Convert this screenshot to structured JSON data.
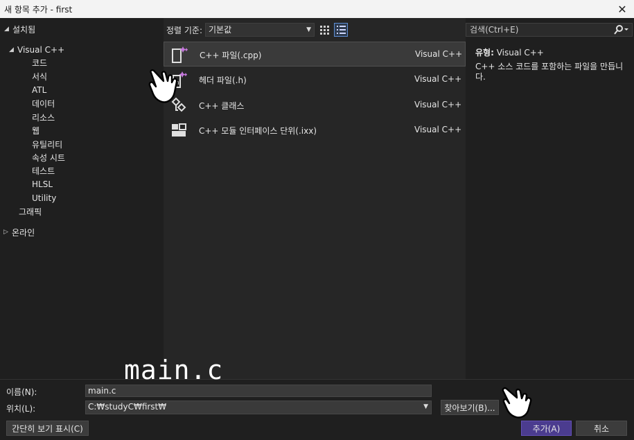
{
  "window": {
    "title": "새 항목 추가 - first",
    "close_glyph": "✕"
  },
  "left": {
    "installed": "설치됨",
    "visual_cpp": "Visual C++",
    "children": [
      "코드",
      "서식",
      "ATL",
      "데이터",
      "리소스",
      "웹",
      "유틸리티",
      "속성 시트",
      "테스트",
      "HLSL",
      "Utility"
    ],
    "graphics": "그래픽",
    "online": "온라인"
  },
  "toolbar": {
    "sort_label": "정렬 기준:",
    "sort_value": "기본값"
  },
  "templates": [
    {
      "name": "C++ 파일(.cpp)",
      "type": "Visual C++",
      "icon": "cpp-file-icon"
    },
    {
      "name": "헤더 파일(.h)",
      "type": "Visual C++",
      "icon": "header-file-icon"
    },
    {
      "name": "C++ 클래스",
      "type": "Visual C++",
      "icon": "cpp-class-icon"
    },
    {
      "name": "C++ 모듈 인터페이스 단위(.ixx)",
      "type": "Visual C++",
      "icon": "module-interface-icon"
    }
  ],
  "right": {
    "search_placeholder": "검색(Ctrl+E)",
    "type_label": "유형:",
    "type_value": "Visual C++",
    "description": "C++ 소스 코드를 포함하는 파일을 만듭니다."
  },
  "bottom": {
    "name_label": "이름(N):",
    "name_value": "main.c",
    "location_label": "위치(L):",
    "location_value": "C:₩studyC₩first₩",
    "browse": "찾아보기(B)...",
    "compact_view": "간단히 보기 표시(C)",
    "add": "추가(A)",
    "cancel": "취소"
  },
  "annotation": {
    "text": "main.c"
  },
  "colors": {
    "accent": "#6450b8",
    "selection": "#3a3a3a",
    "sparkle": "#c678dd"
  }
}
